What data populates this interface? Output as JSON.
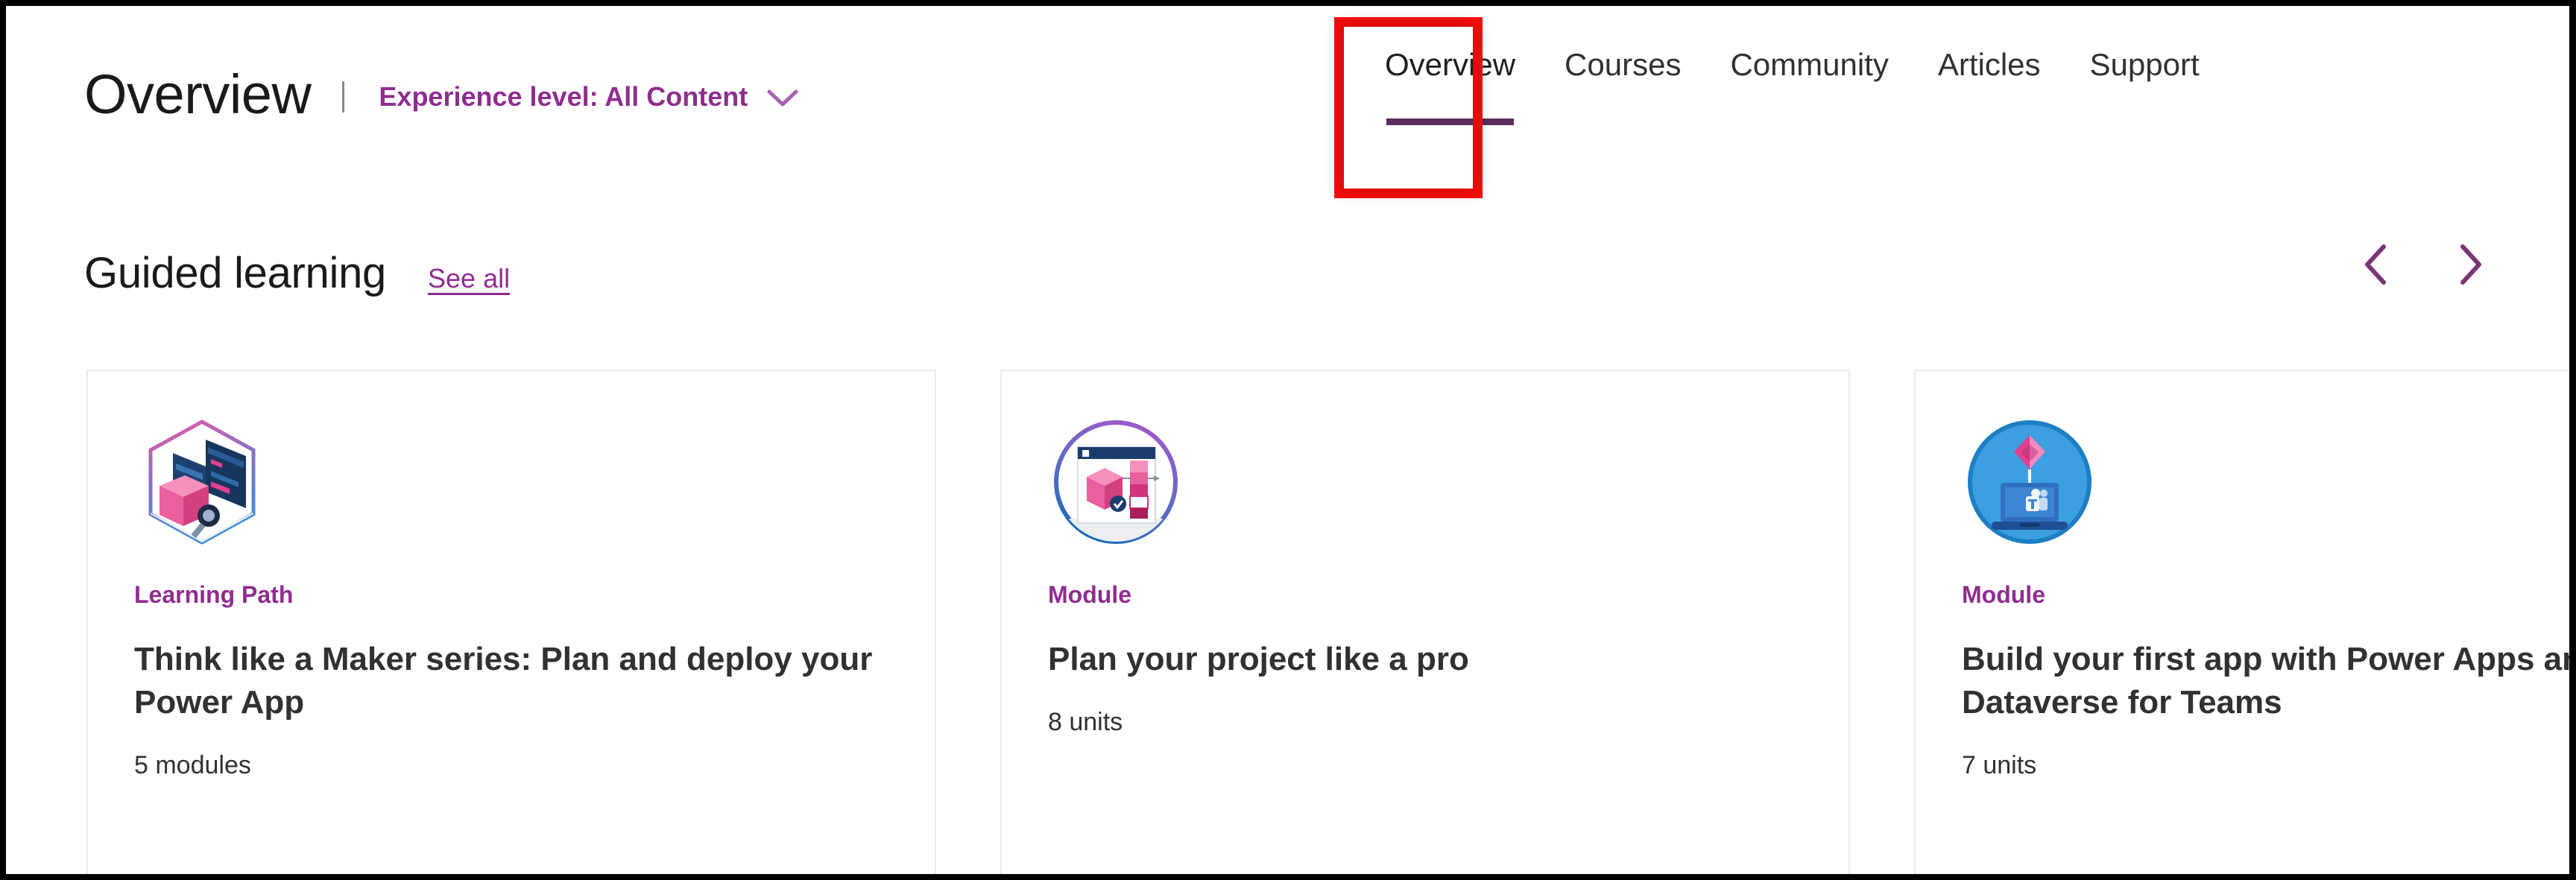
{
  "header": {
    "title": "Overview",
    "divider": "|",
    "filter_label": "Experience level: All Content",
    "filter_chevron_icon": "chevron-down-icon"
  },
  "nav": {
    "tabs": [
      {
        "label": "Overview",
        "active": true
      },
      {
        "label": "Courses",
        "active": false
      },
      {
        "label": "Community",
        "active": false
      },
      {
        "label": "Articles",
        "active": false
      },
      {
        "label": "Support",
        "active": false
      }
    ]
  },
  "annotation": {
    "target": "Overview",
    "color": "#fc0d0d"
  },
  "section": {
    "title": "Guided learning",
    "see_all_label": "See all",
    "prev_icon": "chevron-left-icon",
    "next_icon": "chevron-right-icon"
  },
  "cards": [
    {
      "icon": "learning-path-hexagon-icon",
      "type": "Learning Path",
      "title": "Think like a Maker series: Plan and deploy your Power App",
      "meta": "5 modules"
    },
    {
      "icon": "module-circle-planning-icon",
      "type": "Module",
      "title": "Plan your project like a pro",
      "meta": "8 units"
    },
    {
      "icon": "module-circle-teams-dataverse-icon",
      "type": "Module",
      "title": "Build your first app with Power Apps and Dataverse for Teams",
      "meta": "7 units"
    }
  ],
  "colors": {
    "brand_purple": "#8f2d8f",
    "active_underline": "#5c2d5c",
    "text_primary": "#323130",
    "card_border": "#edebe9",
    "annotation_red": "#fc0d0d"
  }
}
